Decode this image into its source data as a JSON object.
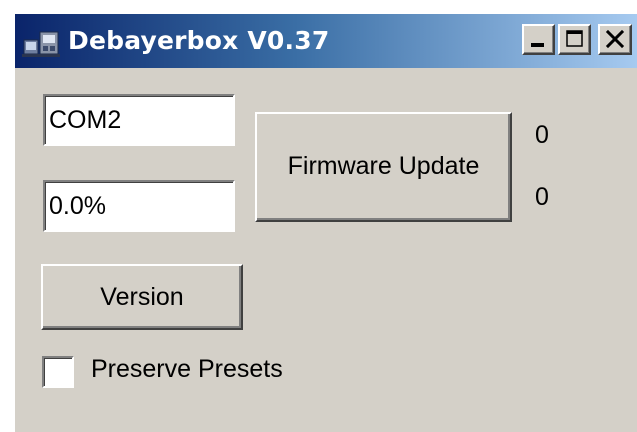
{
  "window": {
    "title": "Debayerbox V0.37",
    "icon": "app-icon",
    "controls": [
      "minimize-icon",
      "maximize-icon",
      "close-icon"
    ]
  },
  "form": {
    "com_port_value": "COM2",
    "progress_value": "0.0%",
    "firmware_button_label": "Firmware Update",
    "version_button_label": "Version",
    "counter_1": "0",
    "counter_2": "0",
    "preserve_presets_label": "Preserve Presets",
    "preserve_presets_checked": false
  },
  "colors": {
    "face": "#d4d0c8",
    "title_start": "#0a246a",
    "title_end": "#a6caf0",
    "title_text": "#ffffff"
  }
}
